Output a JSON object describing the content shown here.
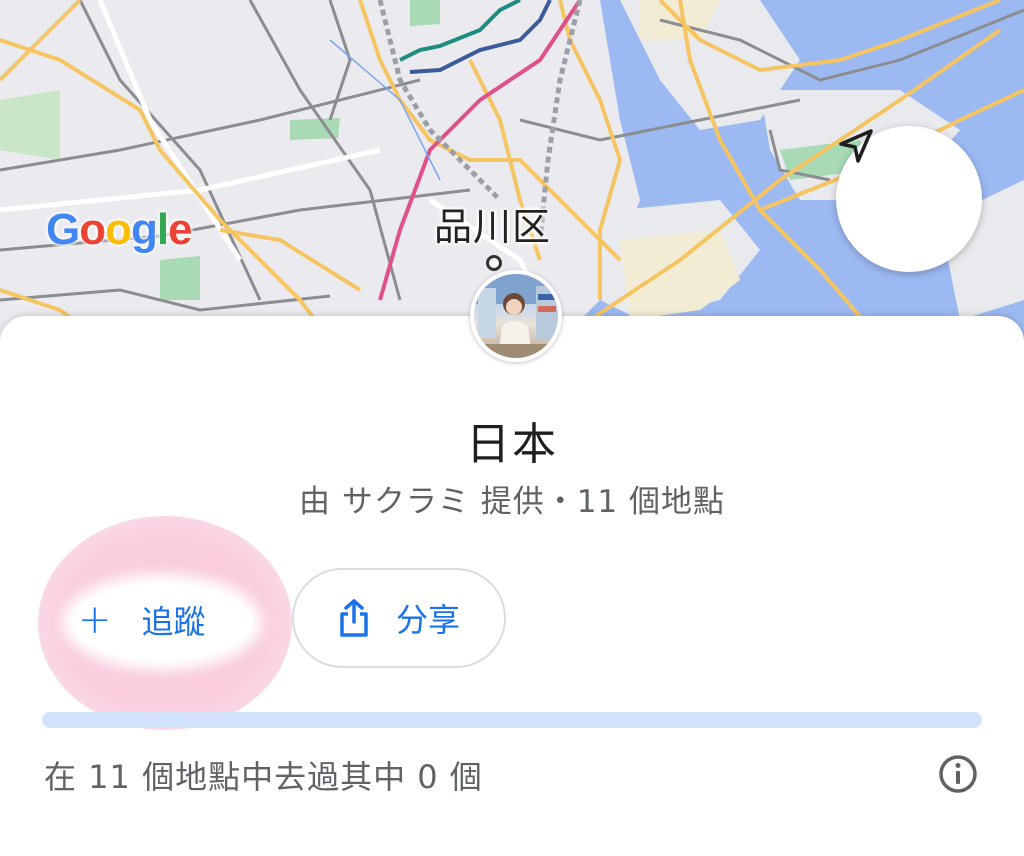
{
  "map": {
    "logo_letters": [
      {
        "char": "G",
        "color": "#4285F4"
      },
      {
        "char": "o",
        "color": "#EA4335"
      },
      {
        "char": "o",
        "color": "#FBBC05"
      },
      {
        "char": "g",
        "color": "#4285F4"
      },
      {
        "char": "l",
        "color": "#34A853"
      },
      {
        "char": "e",
        "color": "#EA4335"
      }
    ],
    "district_label": "品川区",
    "locate_icon": "navigation-arrow-icon"
  },
  "list": {
    "title": "日本",
    "subtitle": "由 サクラミ 提供・11 個地點",
    "follow_label": "追蹤",
    "share_label": "分享",
    "progress_fraction": 0,
    "progress_text": "在 11 個地點中去過其中 0 個",
    "info_icon": "info-icon"
  },
  "colors": {
    "accent": "#1a73e8",
    "progress_track": "#d3e3fd",
    "highlight": "#f9ccdd"
  }
}
